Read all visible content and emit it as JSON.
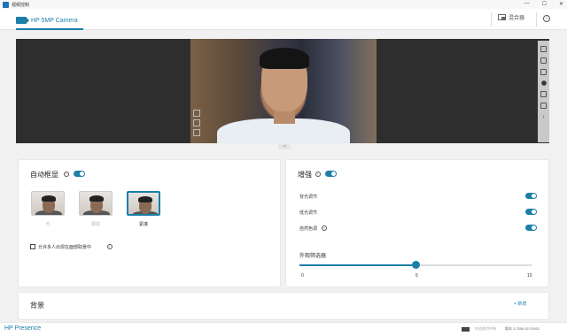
{
  "titlebar": {
    "app_title": "视频控制",
    "controls": [
      "—",
      "☐",
      "✕"
    ]
  },
  "header": {
    "camera_tab": "HP 5MP Camera",
    "mixer_label": "混合器"
  },
  "auto_frame": {
    "title": "自动框显",
    "enabled": true,
    "modes": [
      {
        "label": "无",
        "selected": false
      },
      {
        "label": "跟踪",
        "selected": false
      },
      {
        "label": "紧凑",
        "selected": true
      }
    ],
    "multi_person_label": "允许多人出现在面部取景中"
  },
  "enhance": {
    "title": "增强",
    "enabled": true,
    "rows": [
      {
        "label": "背光调节",
        "on": true
      },
      {
        "label": "低光调节",
        "on": true
      },
      {
        "label": "自然色调",
        "on": true
      }
    ],
    "beauty_filter": {
      "label": "外观筛选器",
      "min": 0,
      "max": 10,
      "value": 5,
      "ticks": [
        "0",
        "5",
        "10"
      ]
    }
  },
  "background": {
    "title": "背景",
    "add_label": "+ 新增"
  },
  "footer": {
    "brand": "HP Presence",
    "status": "电池使用中断",
    "version": "版本 3.2306.92.20501"
  },
  "colors": {
    "accent": "#1b7fa8"
  }
}
